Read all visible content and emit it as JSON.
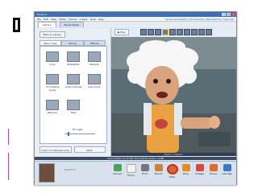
{
  "app": {
    "title": "Picasa 3",
    "account": "[email protected] | Synchronize | Web Albums | Sign Out"
  },
  "menu": [
    "File",
    "Edit",
    "View",
    "Folder",
    "Picture",
    "Create",
    "Tools",
    "Help"
  ],
  "tabs": [
    {
      "label": "Library"
    },
    {
      "label": "Movie Maker"
    }
  ],
  "left_panel": {
    "back_label": "Back to Library",
    "panel_tabs": [
      "Basic Fixes",
      "Tuning",
      "Effects"
    ],
    "tools": [
      "Crop",
      "Straighten",
      "Redeye",
      "I'm Feeling Lucky",
      "Auto Contrast",
      "Auto Color",
      "Retouch",
      "Text"
    ],
    "slider_label": "Fill Light",
    "undo_label": "Undo I'm Feeling Lucky",
    "redo_label": "Redo"
  },
  "viewer": {
    "play_label": "Play",
    "caption": "Make a caption!"
  },
  "status": {
    "text": "10/15/2009 12:45 PM  3072x2048 pixels  1.1MB"
  },
  "tray": {
    "selection_label": "Selection",
    "buttons": [
      "Upload",
      "Email",
      "Print",
      "Export",
      "Shop",
      "Blog",
      "Collage",
      "Movie",
      "Geo-Tag"
    ]
  },
  "colors": {
    "accent": "#3c6fb5",
    "highlight_ring": "#d6261e"
  }
}
